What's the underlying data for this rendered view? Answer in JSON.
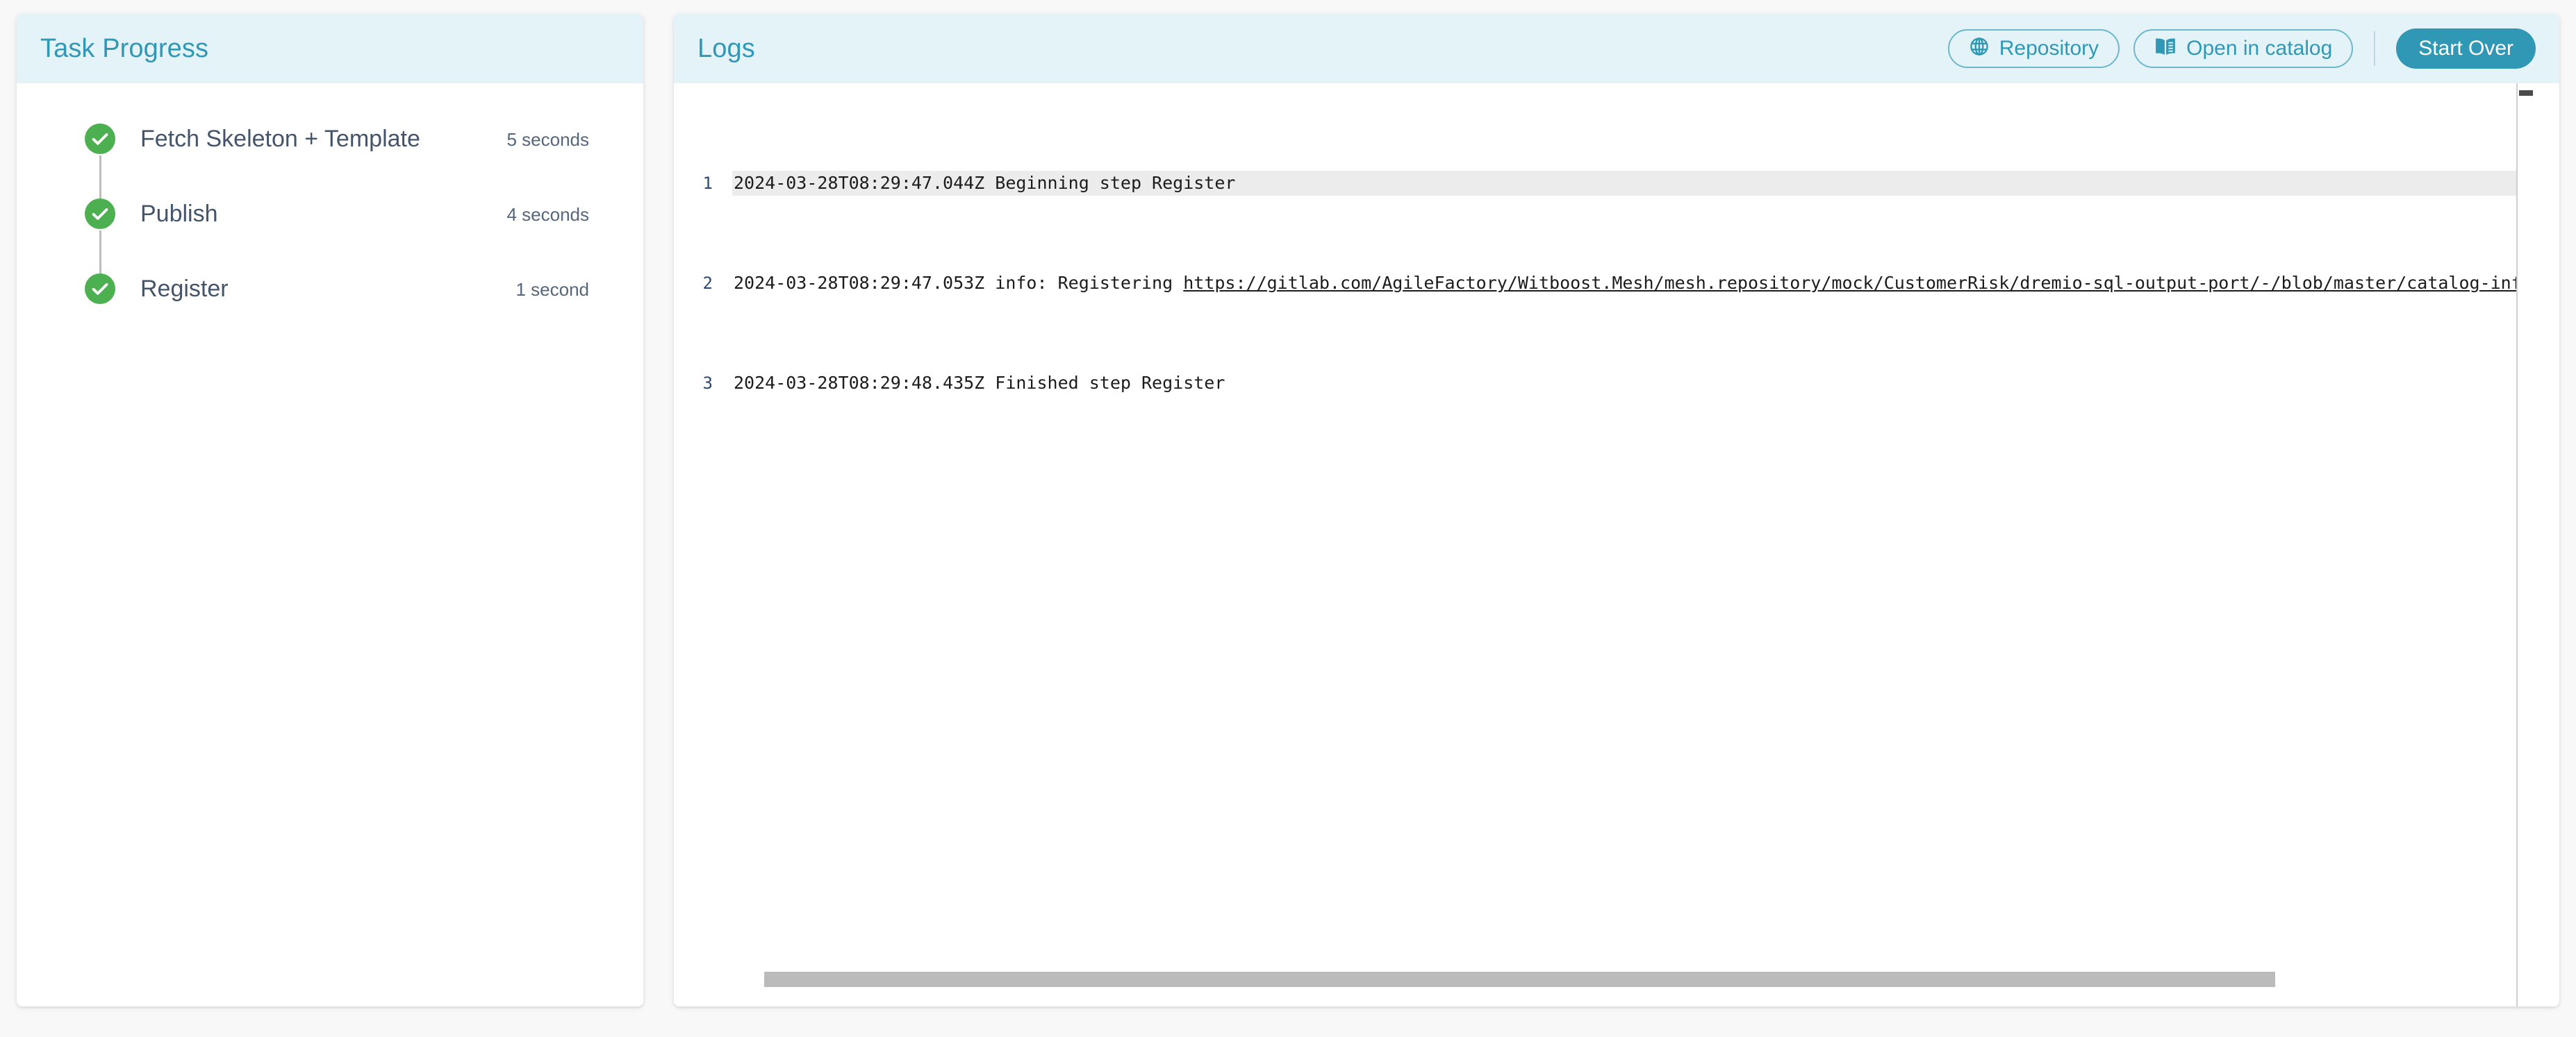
{
  "colors": {
    "page_background": "#f8f8f8",
    "header_band": "#e3f3f8",
    "accent_teal": "#3098b5",
    "success_green": "#4cb050",
    "task_text": "#44556b",
    "line_number": "#2a4a75",
    "scrollbar": "#bbbbbb"
  },
  "task_panel": {
    "title": "Task Progress",
    "steps": [
      {
        "label": "Fetch Skeleton + Template",
        "duration": "5 seconds",
        "status": "success",
        "icon": "check-circle-icon"
      },
      {
        "label": "Publish",
        "duration": "4 seconds",
        "status": "success",
        "icon": "check-circle-icon"
      },
      {
        "label": "Register",
        "duration": "1 second",
        "status": "success",
        "icon": "check-circle-icon"
      }
    ]
  },
  "logs_panel": {
    "title": "Logs",
    "actions": {
      "repository": {
        "label": "Repository",
        "icon": "globe-icon"
      },
      "open_in_catalog": {
        "label": "Open in catalog",
        "icon": "menu-book-icon"
      },
      "start_over": {
        "label": "Start Over"
      }
    },
    "lines": [
      {
        "number": "1",
        "highlighted": true,
        "text": "2024-03-28T08:29:47.044Z Beginning step Register"
      },
      {
        "number": "2",
        "highlighted": false,
        "prefix": "2024-03-28T08:29:47.053Z info: Registering ",
        "url": "https://gitlab.com/AgileFactory/Witboost.Mesh/mesh.repository/mock/CustomerRisk/dremio-sql-output-port/-/blob/master/catalog-info.y"
      },
      {
        "number": "3",
        "highlighted": false,
        "text": "2024-03-28T08:29:48.435Z Finished step Register"
      }
    ]
  }
}
